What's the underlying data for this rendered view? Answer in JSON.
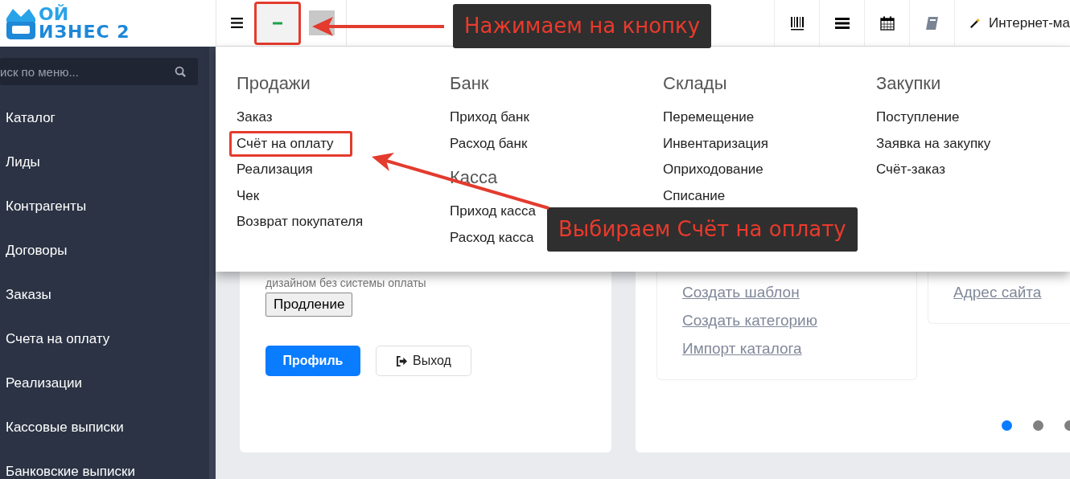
{
  "logo": {
    "lines": [
      "ОЙ",
      "ИЗНЕС 2"
    ]
  },
  "sidebar": {
    "search": {
      "placeholder": "иск по меню..."
    },
    "items": [
      "Каталог",
      "Лиды",
      "Контрагенты",
      "Договоры",
      "Заказы",
      "Счета на оплату",
      "Реализации",
      "Кассовые выписки",
      "Банковские выписки"
    ]
  },
  "topbar": {
    "menu_toggle": {
      "menu_open": true,
      "highlighted": true
    },
    "shop_link": "Интернет-ма"
  },
  "mega_menu": {
    "columns": [
      {
        "sections": [
          {
            "title": "Продажи",
            "items": [
              {
                "label": "Заказ",
                "highlighted": false
              },
              {
                "label": "Счёт на оплату",
                "highlighted": true
              },
              {
                "label": "Реализация",
                "highlighted": false
              },
              {
                "label": "Чек",
                "highlighted": false
              },
              {
                "label": "Возврат покупателя",
                "highlighted": false
              }
            ]
          }
        ]
      },
      {
        "sections": [
          {
            "title": "Банк",
            "items": [
              {
                "label": "Приход банк",
                "highlighted": false
              },
              {
                "label": "Расход банк",
                "highlighted": false
              }
            ]
          },
          {
            "title": "Касса",
            "items": [
              {
                "label": "Приход касса",
                "highlighted": false
              },
              {
                "label": "Расход касса",
                "highlighted": false
              }
            ]
          }
        ]
      },
      {
        "sections": [
          {
            "title": "Склады",
            "items": [
              {
                "label": "Перемещение",
                "highlighted": false
              },
              {
                "label": "Инвентаризация",
                "highlighted": false
              },
              {
                "label": "Оприходование",
                "highlighted": false
              },
              {
                "label": "Списание",
                "highlighted": false
              }
            ]
          }
        ]
      },
      {
        "sections": [
          {
            "title": "Закупки",
            "items": [
              {
                "label": "Поступление",
                "highlighted": false
              },
              {
                "label": "Заявка на закупку",
                "highlighted": false
              },
              {
                "label": "Счёт-заказ",
                "highlighted": false
              }
            ]
          }
        ]
      }
    ]
  },
  "account_card": {
    "note": "дизайном без системы оплаты",
    "renew_button": "Продление",
    "profile_button": "Профиль",
    "logout_button": "Выход"
  },
  "catalog_card": {
    "links": [
      "Создать шаблон",
      "Создать категорию",
      "Импорт каталога"
    ],
    "site_links": [
      "Адрес сайта"
    ],
    "dots": [
      {
        "selected": true
      },
      {
        "selected": false
      },
      {
        "selected": false
      }
    ]
  },
  "annotations": [
    {
      "kind": "callout",
      "text": "Нажимаем на кнопку"
    },
    {
      "kind": "callout",
      "text": "Выбираем Счёт на оплату"
    }
  ]
}
